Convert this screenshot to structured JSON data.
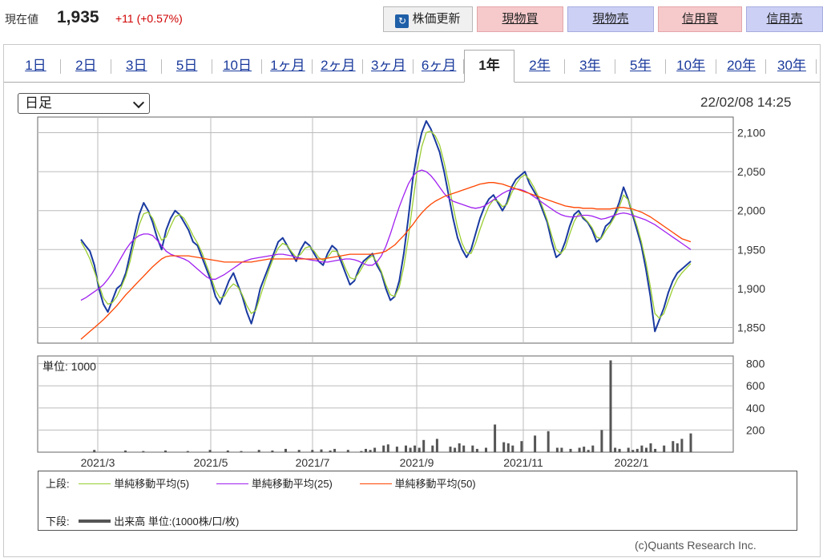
{
  "header": {
    "price_label": "現在値",
    "price": "1,935",
    "change": "+11 (+0.57%)",
    "update_button": "株価更新",
    "buy_label": "現物買",
    "sell_label": "現物売",
    "margin_buy_label": "信用買",
    "margin_sell_label": "信用売"
  },
  "colors": {
    "up": "#d00000",
    "price_line": "#1a3aa0",
    "ma5": "#9acd32",
    "ma25": "#a020f0",
    "ma50": "#ff4500",
    "volume": "#555555"
  },
  "tabs": [
    "1日",
    "2日",
    "3日",
    "5日",
    "10日",
    "1ヶ月",
    "2ヶ月",
    "3ヶ月",
    "6ヶ月",
    "1年",
    "2年",
    "3年",
    "5年",
    "10年",
    "20年",
    "30年"
  ],
  "active_tab": "1年",
  "period_select": "日足",
  "timestamp": "22/02/08 14:25",
  "legend": {
    "upper_label": "上段:",
    "lower_label": "下段:",
    "ma5": "単純移動平均(5)",
    "ma25": "単純移動平均(25)",
    "ma50": "単純移動平均(50)",
    "volume": "出来高 単位:(1000株/口/枚)"
  },
  "credit": "(c)Quants Research Inc.",
  "chart_data": [
    {
      "type": "line",
      "x_ticks": [
        "2021/3",
        "2021/5",
        "2021/7",
        "2021/9",
        "2021/11",
        "2022/1"
      ],
      "y_ticks": [
        "1,850",
        "1,900",
        "1,950",
        "2,000",
        "2,050",
        "2,100"
      ],
      "ylim": [
        1830,
        2120
      ],
      "grid": true,
      "series": [
        {
          "name": "",
          "values": [
            1963,
            1955,
            1948,
            1930,
            1900,
            1880,
            1870,
            1885,
            1900,
            1905,
            1920,
            1945,
            1970,
            1995,
            2010,
            2000,
            1985,
            1965,
            1950,
            1975,
            1990,
            2000,
            1995,
            1985,
            1975,
            1960,
            1955,
            1940,
            1925,
            1910,
            1890,
            1880,
            1895,
            1910,
            1920,
            1905,
            1890,
            1870,
            1855,
            1875,
            1900,
            1915,
            1930,
            1945,
            1960,
            1965,
            1955,
            1945,
            1935,
            1950,
            1960,
            1955,
            1945,
            1935,
            1930,
            1945,
            1955,
            1950,
            1935,
            1920,
            1905,
            1910,
            1925,
            1935,
            1940,
            1945,
            1930,
            1920,
            1900,
            1885,
            1890,
            1910,
            1945,
            1990,
            2040,
            2075,
            2100,
            2115,
            2105,
            2090,
            2075,
            2050,
            2020,
            1990,
            1965,
            1950,
            1940,
            1950,
            1970,
            1990,
            2005,
            2015,
            2020,
            2010,
            2000,
            2010,
            2030,
            2040,
            2045,
            2050,
            2035,
            2025,
            2015,
            2000,
            1985,
            1960,
            1940,
            1945,
            1960,
            1980,
            1995,
            2000,
            1990,
            1985,
            1975,
            1960,
            1965,
            1980,
            1985,
            1995,
            2010,
            2030,
            2015,
            1995,
            1975,
            1955,
            1925,
            1890,
            1845,
            1860,
            1875,
            1895,
            1910,
            1920,
            1925,
            1930,
            1935
          ]
        },
        {
          "name": "単純移動平均(5)",
          "values": [
            1960,
            1950,
            1938,
            1922,
            1905,
            1888,
            1880,
            1882,
            1890,
            1902,
            1916,
            1936,
            1960,
            1982,
            1996,
            1998,
            1990,
            1975,
            1962,
            1966,
            1980,
            1992,
            1995,
            1990,
            1980,
            1968,
            1958,
            1946,
            1930,
            1915,
            1898,
            1888,
            1890,
            1900,
            1906,
            1902,
            1892,
            1878,
            1868,
            1872,
            1890,
            1908,
            1925,
            1940,
            1952,
            1958,
            1955,
            1947,
            1940,
            1944,
            1952,
            1954,
            1948,
            1940,
            1936,
            1940,
            1948,
            1948,
            1940,
            1926,
            1914,
            1912,
            1920,
            1930,
            1938,
            1942,
            1934,
            1922,
            1905,
            1892,
            1890,
            1902,
            1928,
            1965,
            2010,
            2052,
            2082,
            2100,
            2102,
            2096,
            2084,
            2062,
            2035,
            2005,
            1978,
            1958,
            1946,
            1945,
            1958,
            1976,
            1992,
            2006,
            2014,
            2012,
            2005,
            2008,
            2022,
            2034,
            2042,
            2046,
            2040,
            2030,
            2018,
            2004,
            1988,
            1968,
            1950,
            1945,
            1952,
            1970,
            1986,
            1996,
            1992,
            1986,
            1978,
            1966,
            1964,
            1974,
            1982,
            1992,
            2004,
            2020,
            2014,
            1998,
            1980,
            1960,
            1934,
            1902,
            1868,
            1862,
            1868,
            1884,
            1900,
            1912,
            1920,
            1926,
            1932
          ]
        },
        {
          "name": "単純移動平均(25)",
          "values": [
            1885,
            1888,
            1892,
            1896,
            1900,
            1905,
            1912,
            1920,
            1930,
            1940,
            1950,
            1958,
            1964,
            1968,
            1970,
            1970,
            1968,
            1962,
            1955,
            1948,
            1944,
            1942,
            1940,
            1938,
            1935,
            1930,
            1925,
            1920,
            1915,
            1912,
            1912,
            1915,
            1918,
            1922,
            1926,
            1930,
            1934,
            1936,
            1938,
            1939,
            1940,
            1941,
            1942,
            1943,
            1944,
            1944,
            1943,
            1942,
            1940,
            1939,
            1938,
            1937,
            1936,
            1935,
            1934,
            1934,
            1935,
            1936,
            1937,
            1938,
            1938,
            1937,
            1935,
            1932,
            1930,
            1930,
            1934,
            1942,
            1954,
            1970,
            1988,
            2005,
            2020,
            2034,
            2044,
            2050,
            2052,
            2050,
            2045,
            2038,
            2030,
            2022,
            2016,
            2012,
            2010,
            2008,
            2006,
            2004,
            2003,
            2004,
            2006,
            2010,
            2014,
            2018,
            2022,
            2025,
            2027,
            2028,
            2027,
            2025,
            2022,
            2018,
            2014,
            2010,
            2006,
            2002,
            1998,
            1995,
            1993,
            1992,
            1992,
            1993,
            1994,
            1994,
            1993,
            1991,
            1989,
            1990,
            1992,
            1994,
            1996,
            1997,
            1996,
            1994,
            1992,
            1990,
            1988,
            1985,
            1982,
            1978,
            1974,
            1970,
            1966,
            1962,
            1958,
            1954,
            1950
          ]
        },
        {
          "name": "単純移動平均(50)",
          "values": [
            1835,
            1840,
            1845,
            1850,
            1855,
            1860,
            1866,
            1872,
            1878,
            1885,
            1892,
            1898,
            1904,
            1910,
            1916,
            1922,
            1928,
            1933,
            1938,
            1941,
            1942,
            1942,
            1942,
            1942,
            1942,
            1941,
            1940,
            1939,
            1938,
            1937,
            1936,
            1935,
            1934,
            1934,
            1934,
            1934,
            1934,
            1934,
            1934,
            1935,
            1936,
            1937,
            1938,
            1938,
            1938,
            1938,
            1938,
            1938,
            1938,
            1938,
            1938,
            1938,
            1938,
            1938,
            1938,
            1939,
            1940,
            1941,
            1942,
            1943,
            1944,
            1944,
            1944,
            1944,
            1944,
            1944,
            1945,
            1946,
            1948,
            1952,
            1956,
            1962,
            1968,
            1975,
            1982,
            1990,
            1997,
            2003,
            2008,
            2012,
            2015,
            2018,
            2020,
            2022,
            2024,
            2026,
            2028,
            2030,
            2032,
            2034,
            2035,
            2036,
            2036,
            2035,
            2034,
            2032,
            2030,
            2028,
            2026,
            2024,
            2022,
            2020,
            2018,
            2016,
            2014,
            2012,
            2010,
            2008,
            2006,
            2005,
            2004,
            2004,
            2003,
            2003,
            2003,
            2002,
            2002,
            2002,
            2002,
            2003,
            2004,
            2004,
            2003,
            2002,
            2000,
            1998,
            1995,
            1992,
            1988,
            1984,
            1980,
            1976,
            1972,
            1968,
            1964,
            1962,
            1960
          ]
        }
      ]
    },
    {
      "type": "bar",
      "title": "単位: 1000",
      "y_ticks": [
        "200",
        "400",
        "600",
        "800"
      ],
      "ylim": [
        0,
        870
      ],
      "grid": true,
      "series": [
        {
          "name": "出来高",
          "values": [
            0,
            0,
            0,
            20,
            0,
            0,
            0,
            0,
            0,
            0,
            15,
            0,
            0,
            0,
            10,
            0,
            0,
            0,
            0,
            15,
            0,
            0,
            0,
            0,
            10,
            0,
            0,
            0,
            0,
            20,
            0,
            0,
            0,
            15,
            0,
            0,
            10,
            0,
            0,
            0,
            20,
            0,
            0,
            15,
            0,
            0,
            30,
            0,
            0,
            20,
            0,
            0,
            20,
            0,
            25,
            0,
            15,
            30,
            0,
            0,
            20,
            0,
            0,
            10,
            30,
            20,
            40,
            0,
            60,
            70,
            0,
            50,
            0,
            60,
            40,
            60,
            40,
            110,
            0,
            60,
            120,
            0,
            0,
            50,
            40,
            80,
            60,
            0,
            60,
            30,
            0,
            40,
            0,
            250,
            0,
            90,
            80,
            60,
            0,
            100,
            0,
            0,
            150,
            0,
            0,
            190,
            0,
            40,
            40,
            0,
            30,
            0,
            40,
            50,
            20,
            60,
            0,
            200,
            0,
            830,
            40,
            30,
            0,
            40,
            20,
            30,
            60,
            40,
            80,
            30,
            0,
            60,
            0,
            100,
            80,
            120,
            0,
            170
          ]
        }
      ]
    }
  ]
}
